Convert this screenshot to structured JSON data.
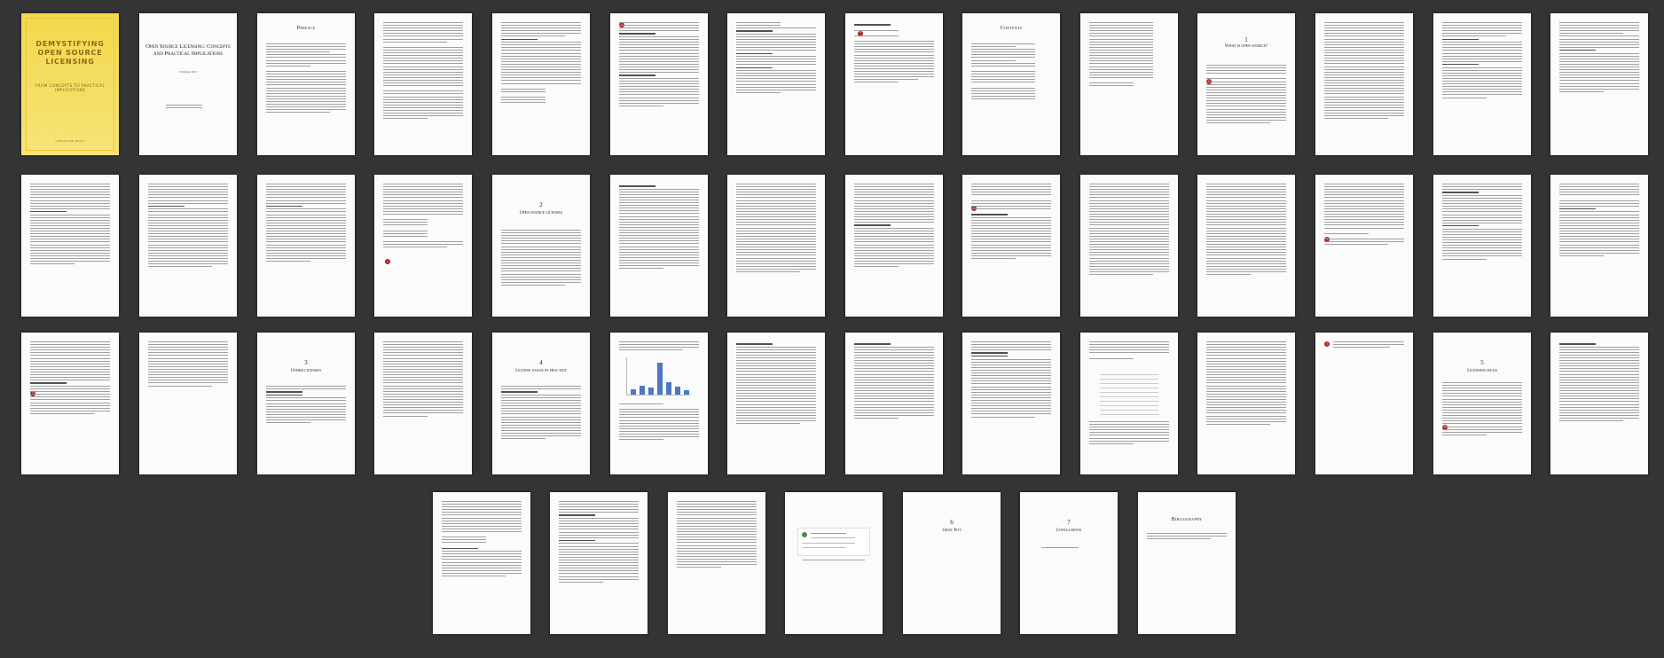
{
  "document": {
    "cover": {
      "title": "DEMYSTIFYING OPEN SOURCE LICENSING",
      "subtitle": "FROM CONCEPTS TO PRACTICAL IMPLICATIONS",
      "author": "CHRISTIAN WOLF"
    },
    "title_page": {
      "title": "Open Source Licensing: Concepts and Practical Implications",
      "author": "Christian Wolf"
    },
    "section_titles": {
      "preface": "Preface",
      "contents": "Contents",
      "bibliography": "Bibliography"
    },
    "chapters": [
      {
        "number": "1",
        "title": "What is open source?"
      },
      {
        "number": "2",
        "title": "Open source licenses"
      },
      {
        "number": "3",
        "title": "Other licenses"
      },
      {
        "number": "4",
        "title": "License usage in practice"
      },
      {
        "number": "5",
        "title": "Licensing bugs"
      },
      {
        "number": "6",
        "title": "Gray Pot"
      },
      {
        "number": "7",
        "title": "Conclusions"
      }
    ]
  },
  "colors": {
    "background": "#343434",
    "cover": "#f3d84a",
    "page": "#fbfbfb",
    "accent": "#b32222",
    "chart_bar": "#4e79c0"
  }
}
